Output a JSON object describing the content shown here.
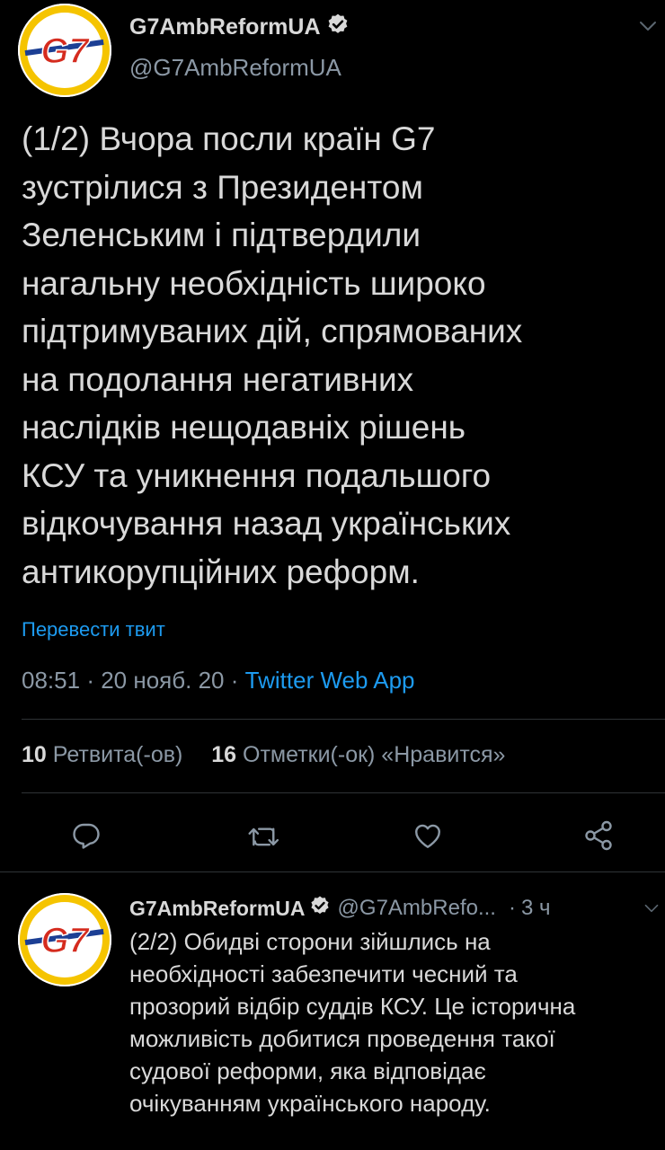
{
  "colors": {
    "background": "#000000",
    "text": "#d9d9d9",
    "secondary": "#8b98a5",
    "link": "#1d9bf0",
    "divider": "#2f3336",
    "logo_red": "#d52b1e",
    "logo_yellow": "#f5c400",
    "logo_blue": "#1c3f94"
  },
  "tweet": {
    "avatar_icon": "g7-logo",
    "name": "G7AmbReformUA",
    "handle": "@G7AmbReformUA",
    "verified_icon": "verified-badge-icon",
    "menu_icon": "chevron-down-icon",
    "text": "(1/2) Вчора посли країн G7\nзустрілися з Президентом\nЗеленським і підтвердили\nнагальну необхідність широко\nпідтримуваних дій, спрямованих\nна подолання негативних\nнаслідків нещодавніх рішень\nКСУ та уникнення подальшого\nвідкочування назад  українських\nантикорупційних реформ.",
    "translate_label": "Перевести твит",
    "time": "08:51",
    "date": "20 нояб. 20",
    "separator": "·",
    "source_app": "Twitter Web App",
    "retweets_count": "10",
    "retweets_label": "Ретвита(-ов)",
    "likes_count": "16",
    "likes_label": "Отметки(-ок) «Нравится»",
    "actions": {
      "reply_icon": "reply-icon",
      "retweet_icon": "retweet-icon",
      "like_icon": "heart-icon",
      "share_icon": "share-icon"
    }
  },
  "reply_tweet": {
    "avatar_icon": "g7-logo",
    "name": "G7AmbReformUA",
    "handle": "@G7AmbRefo...",
    "separator": "·",
    "time": "3 ч",
    "menu_icon": "chevron-down-icon",
    "text": "(2/2) Обидві сторони зійшлись на\nнеобхідності забезпечити чесний та\nпрозорий відбір суддів КСУ. Це історична\nможливість добитися проведення такої\nсудової реформи, яка відповідає\nочікуванням українського народу."
  }
}
